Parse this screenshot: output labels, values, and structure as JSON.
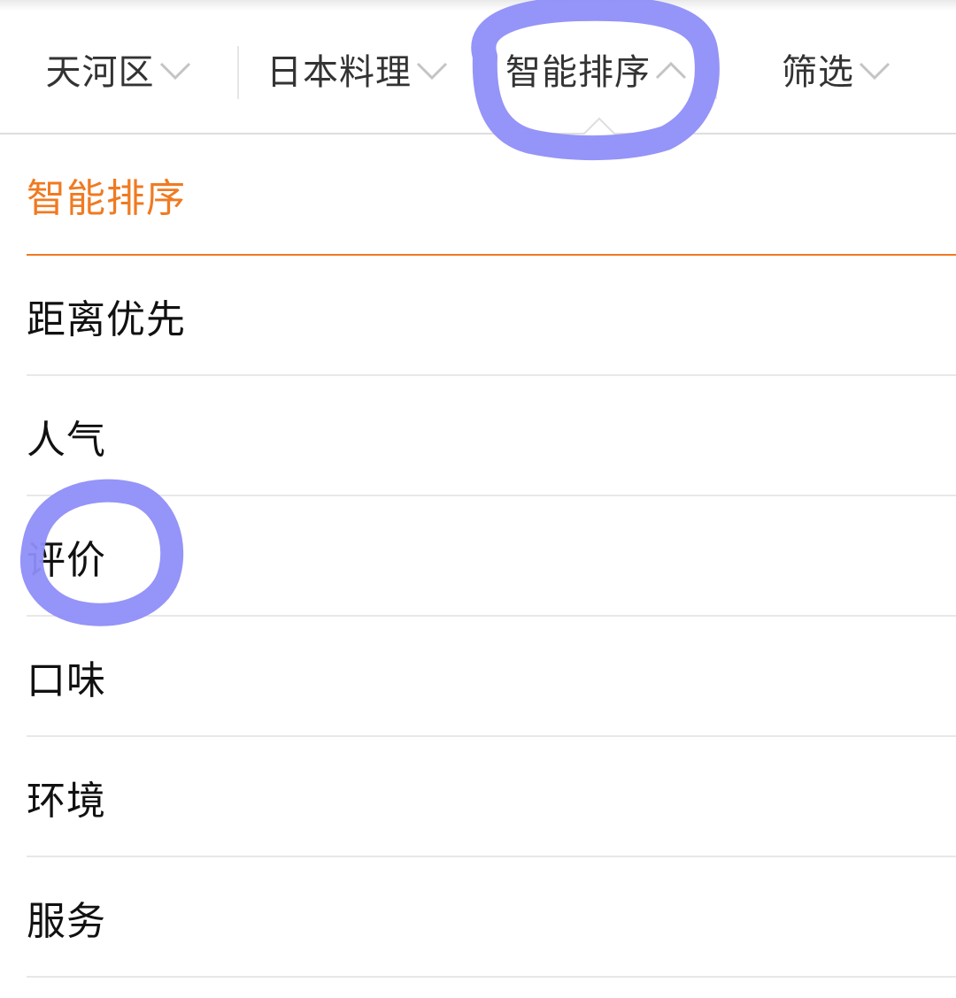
{
  "filter_bar": {
    "tabs": [
      {
        "label": "天河区",
        "state": "collapsed"
      },
      {
        "label": "日本料理",
        "state": "collapsed"
      },
      {
        "label": "智能排序",
        "state": "expanded"
      },
      {
        "label": "筛选",
        "state": "collapsed"
      }
    ],
    "icons": {
      "collapsed": "chevron-down-icon",
      "expanded": "chevron-up-icon"
    }
  },
  "sort_menu": {
    "selected_index": 0,
    "items": [
      {
        "label": "智能排序"
      },
      {
        "label": "距离优先"
      },
      {
        "label": "人气"
      },
      {
        "label": "评价"
      },
      {
        "label": "口味"
      },
      {
        "label": "环境"
      },
      {
        "label": "服务"
      }
    ]
  },
  "colors": {
    "accent": "#f07a21",
    "text": "#111111",
    "tab_text": "#333333",
    "annotation": "#8f8ef8"
  }
}
